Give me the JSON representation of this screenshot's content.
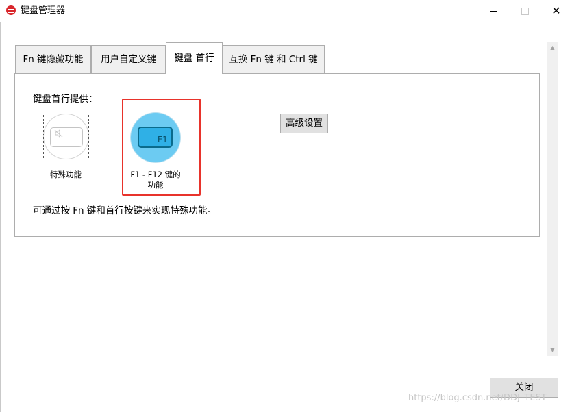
{
  "window": {
    "title": "键盘管理器",
    "controls": {
      "minimize_icon": "minimize-icon",
      "maximize_icon": "maximize-icon",
      "close_glyph": "✕"
    }
  },
  "tabs": [
    {
      "label": "Fn 键隐藏功能",
      "active": false
    },
    {
      "label": "用户自定义键",
      "active": false
    },
    {
      "label": "键盘 首行",
      "active": true
    },
    {
      "label": "互换 Fn 键 和 Ctrl 键",
      "active": false
    }
  ],
  "panel": {
    "provide_label": "键盘首行提供：",
    "options": [
      {
        "label": "特殊功能",
        "icon": "mute-speaker-key-icon",
        "selected": false
      },
      {
        "label_line1": "F1 - F12 键的",
        "label_line2": "功能",
        "key_text": "F1",
        "icon": "f1-key-icon",
        "selected": true
      }
    ],
    "advanced_button": "高级设置",
    "description": "可通过按 Fn 键和首行按键来实现特殊功能。"
  },
  "footer": {
    "close_button": "关闭"
  },
  "watermark": "https://blog.csdn.net/DDJ_TEST",
  "colors": {
    "highlight_border": "#e8332b",
    "selected_circle": "#6ccbf2",
    "selected_key": "#2fb0e6",
    "app_icon": "#d9262b"
  }
}
